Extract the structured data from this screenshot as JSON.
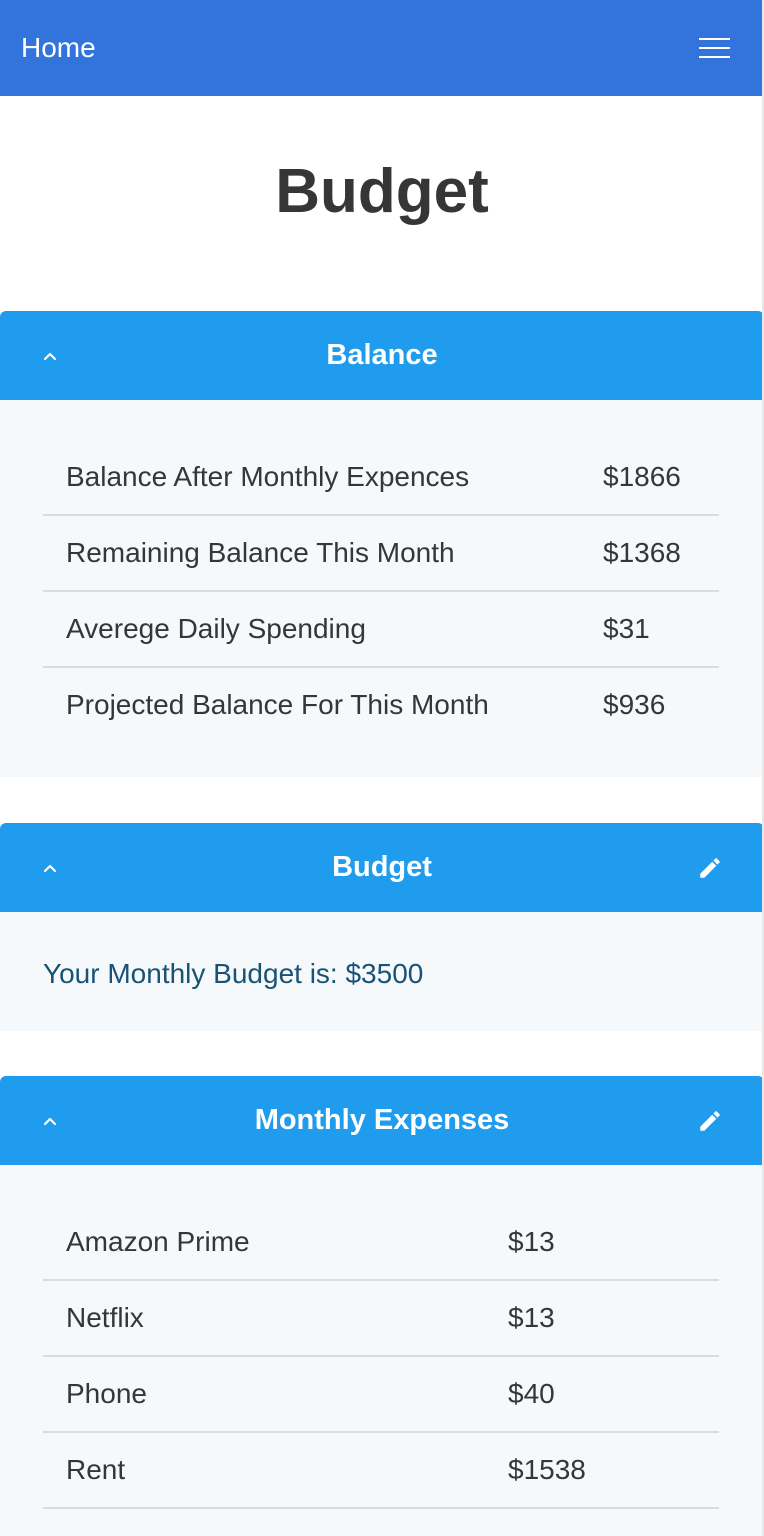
{
  "navbar": {
    "brand": "Home",
    "menu_icon": "hamburger-menu-icon"
  },
  "page": {
    "title": "Budget"
  },
  "balance_panel": {
    "title": "Balance",
    "toggle_icon": "chevron-up-icon",
    "rows": [
      {
        "label": "Balance After Monthly Expences",
        "value": "$1866"
      },
      {
        "label": "Remaining Balance This Month",
        "value": "$1368"
      },
      {
        "label": "Averege Daily Spending",
        "value": "$31"
      },
      {
        "label": "Projected Balance For This Month",
        "value": "$936"
      }
    ]
  },
  "budget_panel": {
    "title": "Budget",
    "toggle_icon": "chevron-up-icon",
    "edit_icon": "pencil-icon",
    "text": "Your Monthly Budget is: $3500"
  },
  "expenses_panel": {
    "title": "Monthly Expenses",
    "toggle_icon": "chevron-up-icon",
    "edit_icon": "pencil-icon",
    "rows": [
      {
        "label": "Amazon Prime",
        "value": "$13"
      },
      {
        "label": "Netflix",
        "value": "$13"
      },
      {
        "label": "Phone",
        "value": "$40"
      },
      {
        "label": "Rent",
        "value": "$1538"
      }
    ]
  },
  "colors": {
    "navbar": "#3273dc",
    "panel_header": "#209cee",
    "panel_body": "#f5f9fc",
    "budget_text": "#1a5276"
  }
}
